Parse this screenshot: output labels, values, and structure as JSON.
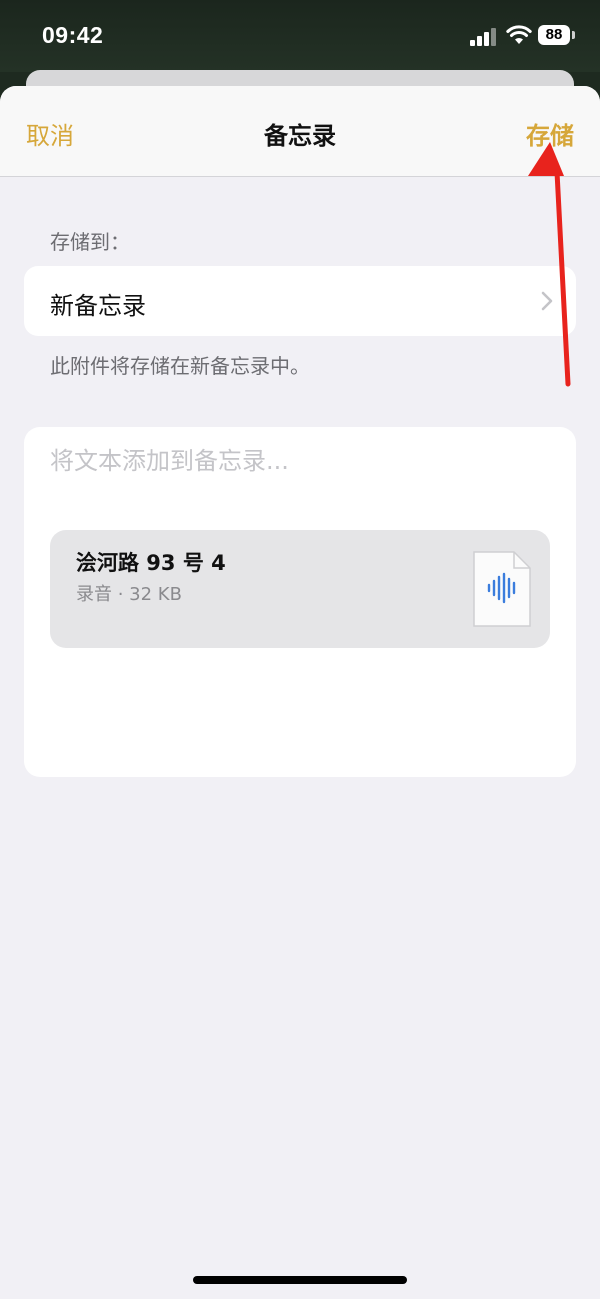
{
  "status_bar": {
    "time": "09:42",
    "battery_level": "88",
    "signal_icon": "signal-bars-icon",
    "wifi_icon": "wifi-icon"
  },
  "nav": {
    "cancel_label": "取消",
    "title": "备忘录",
    "save_label": "存储"
  },
  "destination": {
    "section_label": "存储到：",
    "value": "新备忘录",
    "footnote": "此附件将存储在新备忘录中。"
  },
  "note": {
    "placeholder": "将文本添加到备忘录..."
  },
  "attachment": {
    "title": "浍河路 93 号 4",
    "subtitle": "录音 · 32 KB",
    "icon": "audio-file-icon"
  },
  "colors": {
    "accent": "#d6a73a",
    "annotation_arrow": "#e8231d"
  }
}
